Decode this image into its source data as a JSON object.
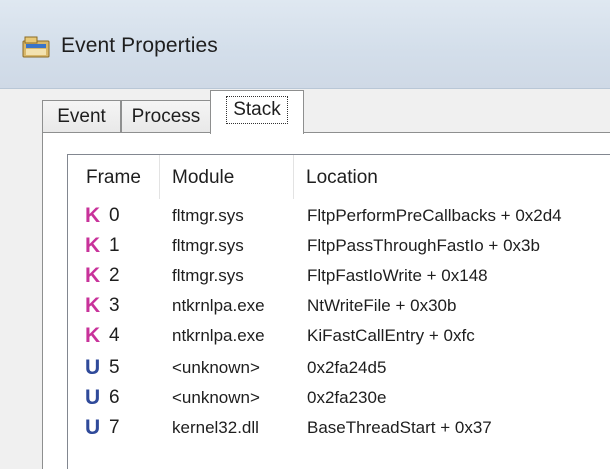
{
  "window": {
    "title": "Event Properties",
    "icon": "event-properties-app-icon"
  },
  "tabs": [
    {
      "label": "Event"
    },
    {
      "label": "Process"
    },
    {
      "label": "Stack",
      "selected": true
    }
  ],
  "stack": {
    "columns": {
      "frame": "Frame",
      "module": "Module",
      "location": "Location"
    },
    "rows": [
      {
        "kind": "K",
        "frame": "0",
        "module": "fltmgr.sys",
        "location": "FltpPerformPreCallbacks + 0x2d4"
      },
      {
        "kind": "K",
        "frame": "1",
        "module": "fltmgr.sys",
        "location": "FltpPassThroughFastIo + 0x3b"
      },
      {
        "kind": "K",
        "frame": "2",
        "module": "fltmgr.sys",
        "location": "FltpFastIoWrite + 0x148"
      },
      {
        "kind": "K",
        "frame": "3",
        "module": "ntkrnlpa.exe",
        "location": "NtWriteFile + 0x30b"
      },
      {
        "kind": "K",
        "frame": "4",
        "module": "ntkrnlpa.exe",
        "location": "KiFastCallEntry + 0xfc"
      },
      {
        "kind": "U",
        "frame": "5",
        "module": "<unknown>",
        "location": "0x2fa24d5"
      },
      {
        "kind": "U",
        "frame": "6",
        "module": "<unknown>",
        "location": "0x2fa230e"
      },
      {
        "kind": "U",
        "frame": "7",
        "module": "kernel32.dll",
        "location": "BaseThreadStart + 0x37"
      }
    ]
  },
  "colors": {
    "kernel_marker": "#c8329a",
    "user_marker": "#2f4a9a"
  }
}
